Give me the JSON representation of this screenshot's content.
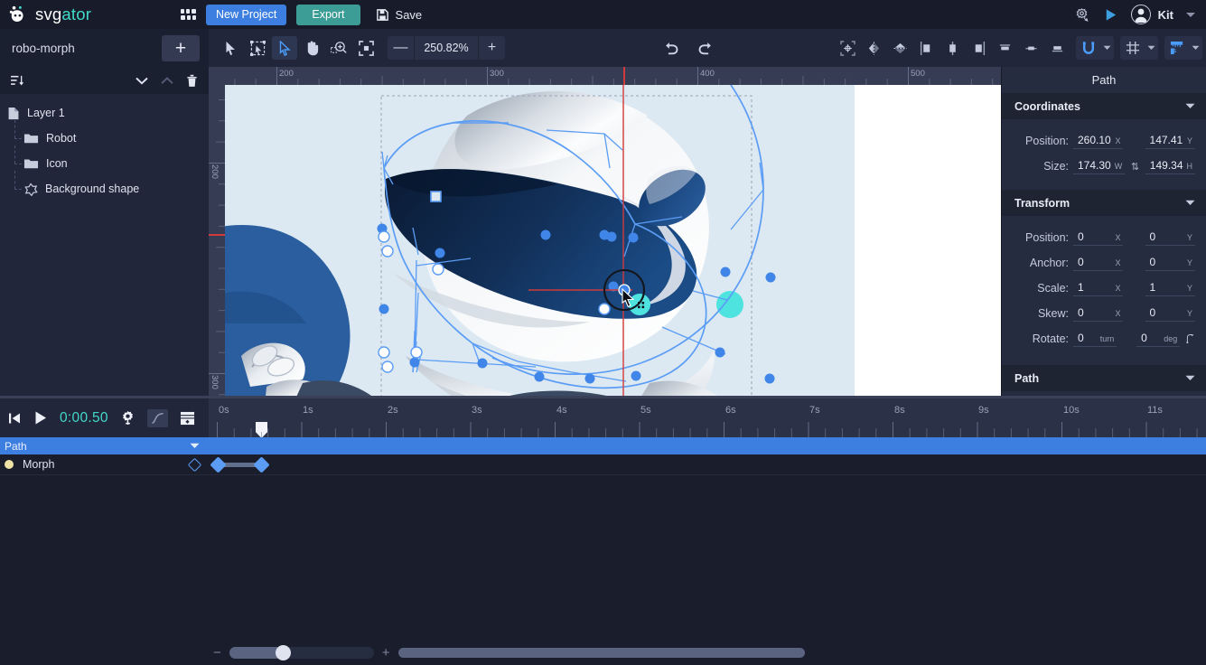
{
  "app": {
    "logo_word1": "svg",
    "logo_word2": "ator"
  },
  "header": {
    "apps_icon": "grid-apps-icon",
    "new_project_label": "New Project",
    "export_label": "Export",
    "save_label": "Save",
    "save_icon": "floppy-disk-icon",
    "plugin_icon": "plugin-gear-icon",
    "preview_icon": "play-preview-icon",
    "avatar_icon": "user-avatar-icon",
    "user_name": "Kit",
    "account_caret_icon": "chevron-down-icon"
  },
  "left_panel": {
    "project_name": "robo-morph",
    "add_button_label": "+",
    "add_button_icon": "plus-icon",
    "tools": {
      "sort_icon": "sort-layers-icon",
      "collapse_down_icon": "chevron-down-icon",
      "collapse_up_icon": "chevron-up-icon",
      "delete_icon": "trash-icon"
    },
    "layers": [
      {
        "label": "Layer 1",
        "icon": "layer-page-icon",
        "depth": 0
      },
      {
        "label": "Robot",
        "icon": "folder-icon",
        "depth": 1
      },
      {
        "label": "Icon",
        "icon": "folder-icon",
        "depth": 1
      },
      {
        "label": "Background shape",
        "icon": "path-star-icon",
        "depth": 1
      }
    ]
  },
  "canvas_toolbar": {
    "tools": [
      {
        "name": "select-tool",
        "icon": "cursor-arrow-icon",
        "active": false
      },
      {
        "name": "transform-tool",
        "icon": "bounding-box-icon",
        "active": false
      },
      {
        "name": "node-edit-tool",
        "icon": "node-cursor-icon",
        "active": true
      },
      {
        "name": "pan-tool",
        "icon": "hand-icon",
        "active": false
      },
      {
        "name": "zoom-tool",
        "icon": "magnifier-plus-icon",
        "active": false
      },
      {
        "name": "fit-tool",
        "icon": "fit-to-screen-icon",
        "active": false
      }
    ],
    "zoom_out_label": "—",
    "zoom_value": "250.82%",
    "zoom_in_label": "+",
    "undo_icon": "undo-arrow-icon",
    "redo_icon": "redo-arrow-icon",
    "right_tools": [
      {
        "name": "align-center-tool",
        "icon": "align-center-box-icon"
      },
      {
        "name": "flip-horizontal-tool",
        "icon": "flip-horizontal-icon"
      },
      {
        "name": "flip-vertical-tool",
        "icon": "flip-vertical-icon"
      },
      {
        "name": "align-left-tool",
        "icon": "align-left-icon"
      },
      {
        "name": "align-center-h-tool",
        "icon": "align-center-h-icon"
      },
      {
        "name": "align-right-tool",
        "icon": "align-right-icon"
      },
      {
        "name": "align-top-tool",
        "icon": "align-top-icon"
      },
      {
        "name": "align-middle-tool",
        "icon": "align-middle-icon"
      },
      {
        "name": "align-bottom-tool",
        "icon": "align-bottom-icon"
      }
    ],
    "snap": {
      "icon": "magnet-icon",
      "active": true,
      "caret_icon": "chevron-down-icon"
    },
    "grid": {
      "icon": "grid-hash-icon",
      "active": false,
      "caret_icon": "chevron-down-icon"
    },
    "rulers": {
      "icon": "ruler-guides-icon",
      "active": true,
      "caret_icon": "chevron-down-icon"
    }
  },
  "canvas": {
    "ruler_h_labels": [
      "200",
      "300",
      "400",
      "500"
    ],
    "ruler_v_labels": [
      "200",
      "300"
    ],
    "selection_shape": "robot-head-path",
    "cursor_icon": "move-node-cursor-icon"
  },
  "right_panel": {
    "title": "Path",
    "sections": [
      {
        "name": "coordinates",
        "label": "Coordinates",
        "caret_icon": "chevron-down-icon"
      },
      {
        "name": "transform",
        "label": "Transform",
        "caret_icon": "chevron-down-icon"
      },
      {
        "name": "path",
        "label": "Path",
        "caret_icon": "chevron-down-icon"
      }
    ],
    "coordinates": {
      "position_label": "Position:",
      "position_x": "260.10",
      "position_x_unit": "X",
      "position_y": "147.41",
      "position_y_unit": "Y",
      "size_label": "Size:",
      "size_w": "174.30",
      "size_w_unit": "W",
      "size_h": "149.34",
      "size_h_unit": "H",
      "lock_ratio_icon": "link-ratio-icon"
    },
    "transform": {
      "rows": [
        {
          "label": "Position:",
          "x": "0",
          "x_unit": "X",
          "y": "0",
          "y_unit": "Y"
        },
        {
          "label": "Anchor:",
          "x": "0",
          "x_unit": "X",
          "y": "0",
          "y_unit": "Y"
        },
        {
          "label": "Scale:",
          "x": "1",
          "x_unit": "X",
          "y": "1",
          "y_unit": "Y"
        },
        {
          "label": "Skew:",
          "x": "0",
          "x_unit": "X",
          "y": "0",
          "y_unit": "Y"
        },
        {
          "label": "Rotate:",
          "x": "0",
          "x_unit": "turn",
          "y": "0",
          "y_unit": "deg"
        }
      ],
      "rotate_extra_icon": "rotate-direction-icon"
    }
  },
  "timeline": {
    "controls": {
      "go_start_icon": "skip-to-start-icon",
      "play_icon": "play-icon",
      "current_time": "0:00.50",
      "settings_icon": "gear-icon",
      "easing_icon": "easing-curve-icon",
      "keyframe_panel_icon": "keyframe-options-icon"
    },
    "ruler_labels": [
      "0s",
      "1s",
      "2s",
      "3s",
      "4s",
      "5s",
      "6s",
      "7s",
      "8s",
      "9s",
      "10s",
      "11s"
    ],
    "tracks": [
      {
        "name": "path-track",
        "label": "Path",
        "selected": true,
        "caret_icon": "chevron-down-icon"
      },
      {
        "name": "morph-track",
        "label": "Morph",
        "dot_color": "#efe2a5",
        "add_keyframe_icon": "diamond-keyframe-icon",
        "keyframes_seconds": [
          0.0,
          0.5
        ]
      }
    ],
    "playhead_seconds": 0.5
  },
  "bottom_bar": {
    "zoom_out_label": "−",
    "zoom_in_label": "+",
    "zoom_slider_value": 32,
    "hscroll_name": "timeline-horizontal-scrollbar"
  },
  "colors": {
    "accent_blue": "#3d7fe0",
    "accent_teal": "#3c9c96",
    "brand_teal": "#43d9c8",
    "panel_dark": "#21263a",
    "canvas_bg": "#2b3147",
    "artboard_bg": "#dce8f2",
    "node_blue": "#5b9df5",
    "eye_cyan": "#4fe3e0",
    "visor_dark": "#0d2344",
    "robot_blue": "#2e62a8"
  }
}
